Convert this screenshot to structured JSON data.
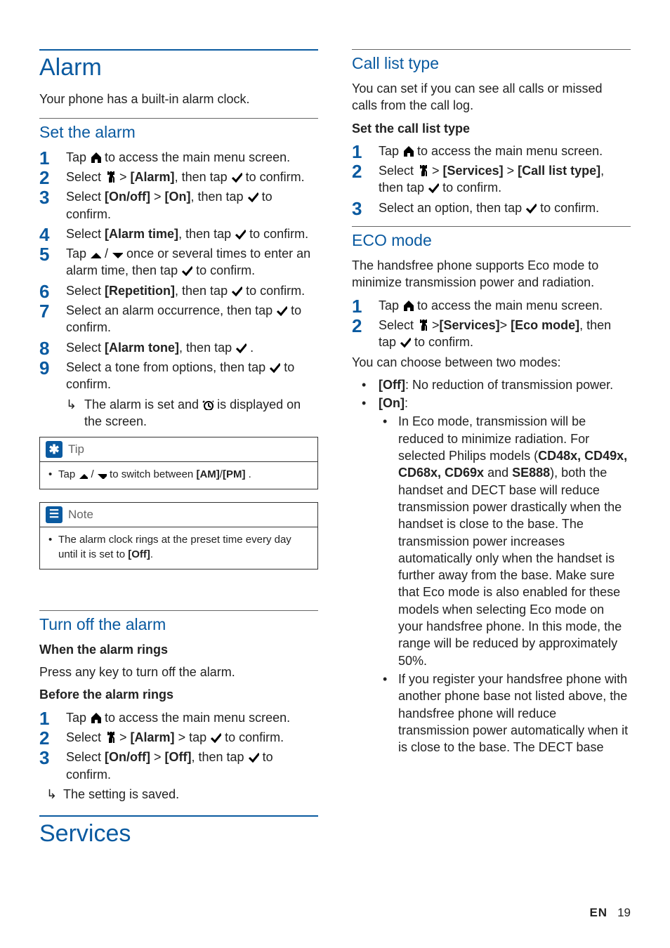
{
  "alarm": {
    "title": "Alarm",
    "intro": "Your phone has a built-in alarm clock.",
    "set": {
      "heading": "Set the alarm",
      "s1a": "Tap ",
      "s1b": " to access the main menu screen.",
      "s2a": "Select ",
      "s2b": " > ",
      "s2c": "[Alarm]",
      "s2d": ", then tap ",
      "s2e": " to confirm.",
      "s3a": "Select ",
      "s3b": "[On/off]",
      "s3c": " > ",
      "s3d": "[On]",
      "s3e": ", then tap ",
      "s3f": " to confirm.",
      "s4a": "Select ",
      "s4b": "[Alarm time]",
      "s4c": ", then tap ",
      "s4d": " to confirm.",
      "s5a": "Tap ",
      "s5b": " / ",
      "s5c": " once or several times to enter an alarm time, then tap ",
      "s5d": " to confirm.",
      "s6a": "Select ",
      "s6b": "[Repetition]",
      "s6c": ", then tap ",
      "s6d": " to confirm.",
      "s7a": "Select an alarm occurrence, then tap ",
      "s7b": " to confirm.",
      "s8a": "Select ",
      "s8b": "[Alarm tone]",
      "s8c": ", then tap ",
      "s8d": " .",
      "s9a": "Select a tone from options, then tap ",
      "s9b": " to confirm.",
      "r1a": "The alarm is set and ",
      "r1b": " is displayed on the screen."
    },
    "tip": {
      "label": "Tip",
      "t1a": "Tap ",
      "t1b": " / ",
      "t1c": " to switch between ",
      "t1d": "[AM]",
      "t1e": "/",
      "t1f": "[PM]",
      "t1g": " ."
    },
    "note": {
      "label": "Note",
      "n1a": "The alarm clock rings at the preset time every day until it is set to ",
      "n1b": "[Off]",
      "n1c": "."
    },
    "off": {
      "heading": "Turn off the alarm",
      "h1": "When the alarm rings",
      "p1": "Press any key to turn off the alarm.",
      "h2": "Before the alarm rings",
      "s1a": "Tap ",
      "s1b": " to access the main menu screen.",
      "s2a": "Select ",
      "s2b": " > ",
      "s2c": "[Alarm]",
      "s2d": " > tap ",
      "s2e": " to confirm.",
      "s3a": "Select ",
      "s3b": "[On/off]",
      "s3c": " > ",
      "s3d": "[Off]",
      "s3e": ", then tap ",
      "s3f": " to confirm.",
      "r": "The setting is saved."
    }
  },
  "services": {
    "title": "Services",
    "call": {
      "heading": "Call list type",
      "intro": "You can set if you can see all calls or missed calls from the call log.",
      "subhead": "Set the call list type",
      "s1a": "Tap ",
      "s1b": " to access the main menu screen.",
      "s2a": "Select ",
      "s2b": " > ",
      "s2c": "[Services]",
      "s2d": " > ",
      "s2e": "[Call list type]",
      "s2f": ", then tap ",
      "s2g": " to confirm.",
      "s3a": "Select an option, then tap ",
      "s3b": " to confirm."
    },
    "eco": {
      "heading": "ECO mode",
      "intro": "The handsfree phone supports Eco mode to minimize transmission power and radiation.",
      "s1a": "Tap ",
      "s1b": " to access the main menu screen.",
      "s2a": "Select ",
      "s2b": " >",
      "s2c": "[Services]",
      "s2d": "> ",
      "s2e": "[Eco mode]",
      "s2f": ", then tap ",
      "s2g": " to confirm.",
      "modes_intro": "You can choose between two modes:",
      "off_a": "[Off]",
      "off_b": ": No reduction of transmission power.",
      "on_a": "[On]",
      "on_b": ":",
      "sub1a": "In Eco mode, transmission will be reduced to minimize radiation. For selected Philips models (",
      "sub1b": "CD48x, CD49x, CD68x, CD69x",
      "sub1c": " and ",
      "sub1d": "SE888",
      "sub1e": "), both the handset and DECT base will reduce transmission power drastically when the handset is close to the base. The transmission power increases automatically only when the handset is further away from the base. Make sure that Eco mode is also enabled for these models when selecting Eco mode on your handsfree phone. In this mode, the range will be reduced by approximately 50%.",
      "sub2": "If you register your handsfree phone with another phone base not listed above, the handsfree phone will reduce transmission power automatically when it is close to the base. The DECT base"
    }
  },
  "footer": {
    "lang": "EN",
    "page": "19"
  }
}
